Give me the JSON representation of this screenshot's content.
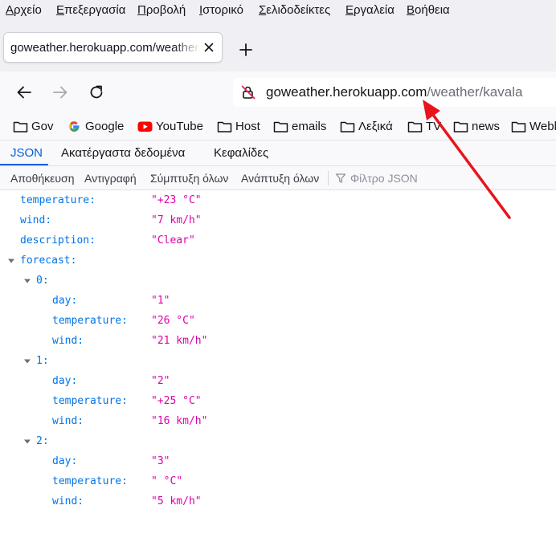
{
  "menubar": {
    "items": [
      {
        "first": "Α",
        "rest": "ρχείο"
      },
      {
        "first": "Ε",
        "rest": "πεξεργασία"
      },
      {
        "first": "Π",
        "rest": "ροβολή"
      },
      {
        "first": "Ι",
        "rest": "στορικό"
      },
      {
        "first": "Σ",
        "rest": "ελιδοδείκτες"
      },
      {
        "first": "Ε",
        "rest": "ργαλεία"
      },
      {
        "first": "Β",
        "rest": "οήθεια"
      }
    ]
  },
  "tab": {
    "title": "goweather.herokuapp.com/weather/kavala"
  },
  "urlbar": {
    "domain": "goweather.herokuapp.com",
    "path": "/weather/kavala"
  },
  "bookmarks": [
    "Gov",
    "Google",
    "YouTube",
    "Host",
    "emails",
    "Λεξικά",
    "TV",
    "news",
    "Webl"
  ],
  "viewer_tabs": {
    "json": "JSON",
    "raw": "Ακατέργαστα δεδομένα",
    "headers": "Κεφαλίδες"
  },
  "json_toolbar": {
    "save": "Αποθήκευση",
    "copy": "Αντιγραφή",
    "collapse": "Σύμπτυξη όλων",
    "expand": "Ανάπτυξη όλων",
    "filter_placeholder": "Φίλτρο JSON"
  },
  "tree": {
    "temperature": {
      "key": "temperature:",
      "val": "\"+23 °C\""
    },
    "wind": {
      "key": "wind:",
      "val": "\"7 km/h\""
    },
    "description": {
      "key": "description:",
      "val": "\"Clear\""
    },
    "forecast": {
      "key": "forecast:"
    },
    "items": [
      {
        "index": "0:",
        "day": {
          "key": "day:",
          "val": "\"1\""
        },
        "temperature": {
          "key": "temperature:",
          "val": "\"26 °C\""
        },
        "wind": {
          "key": "wind:",
          "val": "\"21 km/h\""
        }
      },
      {
        "index": "1:",
        "day": {
          "key": "day:",
          "val": "\"2\""
        },
        "temperature": {
          "key": "temperature:",
          "val": "\"+25 °C\""
        },
        "wind": {
          "key": "wind:",
          "val": "\"16 km/h\""
        }
      },
      {
        "index": "2:",
        "day": {
          "key": "day:",
          "val": "\"3\""
        },
        "temperature": {
          "key": "temperature:",
          "val": "\" °C\""
        },
        "wind": {
          "key": "wind:",
          "val": "\"5 km/h\""
        }
      }
    ]
  },
  "colors": {
    "accent": "#0060df",
    "key": "#0074e8",
    "string": "#dd00a9",
    "annotation_arrow": "#e8141c"
  }
}
